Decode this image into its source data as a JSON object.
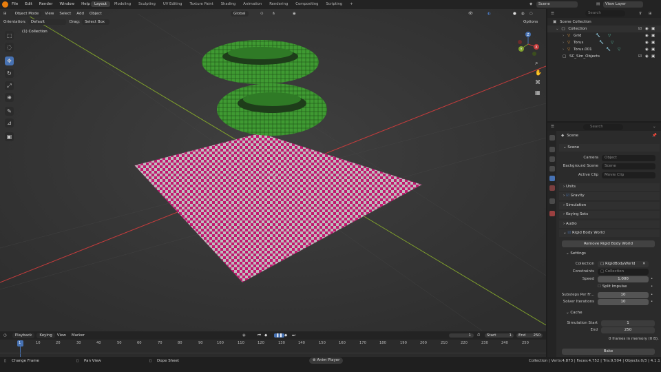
{
  "menu": [
    "File",
    "Edit",
    "Render",
    "Window",
    "Help"
  ],
  "workspaces": [
    "Layout",
    "Modeling",
    "Sculpting",
    "UV Editing",
    "Texture Paint",
    "Shading",
    "Animation",
    "Rendering",
    "Compositing",
    "Scripting",
    "+"
  ],
  "active_workspace": "Layout",
  "scene_name": "Scene",
  "view_layer": "View Layer",
  "viewport": {
    "mode": "Object Mode",
    "menus": [
      "View",
      "Select",
      "Add",
      "Object"
    ],
    "transform_orientation": "Global",
    "orientation_label": "Orientation:",
    "orientation_value": "Default",
    "drag_label": "Drag:",
    "drag_value": "Select Box",
    "options": "Options",
    "collection_label": "(1) Collection",
    "gizmo": {
      "x": "X",
      "y": "Y",
      "z": "Z"
    }
  },
  "outliner": {
    "search_placeholder": "Search",
    "scene_collection": "Scene Collection",
    "collection": "Collection",
    "objects": [
      "Grid",
      "Torus",
      "Torus.001"
    ],
    "sim_collection": "SC_Sim_Objects"
  },
  "properties": {
    "search_placeholder": "Search",
    "breadcrumb": "Scene",
    "scene_panel": "Scene",
    "camera_label": "Camera",
    "camera_placeholder": "Object",
    "background_label": "Background Scene",
    "background_placeholder": "Scene",
    "clip_label": "Active Clip",
    "clip_placeholder": "Movie Clip",
    "units": "Units",
    "gravity": "Gravity",
    "simulation": "Simulation",
    "keying_sets": "Keying Sets",
    "audio": "Audio",
    "rbw": "Rigid Body World",
    "remove_rbw": "Remove Rigid Body World",
    "settings": "Settings",
    "collection_label": "Collection",
    "collection_value": "RigidBodyWorld",
    "constraints_label": "Constraints",
    "constraints_placeholder": "Collection",
    "speed_label": "Speed",
    "speed_value": "1.000",
    "split_impulse": "Split Impulse",
    "substeps_label": "Substeps Per Fr...",
    "substeps_value": "10",
    "solver_label": "Solver Iterations",
    "solver_value": "10",
    "cache": "Cache",
    "sim_start_label": "Simulation Start",
    "sim_start_value": "1",
    "end_label": "End",
    "end_value": "250",
    "frames_in_memory": "0 frames in memory (0 B).",
    "bake": "Bake"
  },
  "timeline": {
    "menus": [
      "Playback",
      "Keying",
      "View",
      "Marker"
    ],
    "current_frame": "1",
    "start_label": "Start",
    "start_value": "1",
    "end_label": "End",
    "end_value": "250",
    "ticks": [
      "1",
      "10",
      "20",
      "30",
      "40",
      "50",
      "60",
      "70",
      "80",
      "90",
      "100",
      "110",
      "120",
      "130",
      "140",
      "150",
      "160",
      "170",
      "180",
      "190",
      "200",
      "210",
      "220",
      "230",
      "240",
      "250"
    ]
  },
  "statusbar": {
    "change_frame": "Change Frame",
    "pan_view": "Pan View",
    "dope_sheet": "Dope Sheet",
    "anim_player": "Anim Player",
    "stats": "Collection | Verts:4,873 | Faces:4,752 | Tris:9,504 | Objects:0/3 | 4.1.1"
  },
  "colors": {
    "accent": "#4772b3",
    "torus": "#3f9a32",
    "checker_a": "#c2186f",
    "checker_b": "#b9b9b9",
    "x_axis": "#c63c3c",
    "y_axis": "#7fa02c"
  }
}
